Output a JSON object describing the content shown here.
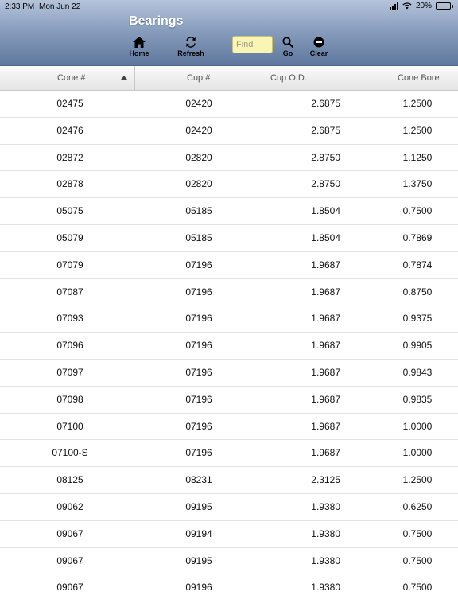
{
  "status_bar": {
    "time": "2:33 PM",
    "date": "Mon Jun 22",
    "battery": "20%",
    "battery_level": 0.2
  },
  "header": {
    "title": "Bearings",
    "toolbar": {
      "home_label": "Home",
      "refresh_label": "Refresh",
      "find_placeholder": "Find",
      "find_value": "",
      "go_label": "Go",
      "clear_label": "Clear"
    },
    "colors": {
      "bar_top": "#b6c4da",
      "bar_bottom": "#5e779c",
      "find_bg": "#fbf5b5"
    }
  },
  "table": {
    "columns": [
      "Cone #",
      "Cup #",
      "Cup O.D.",
      "Cone Bore"
    ],
    "sort_column": "Cone #",
    "sort_direction": "ascending",
    "rows": [
      [
        "02475",
        "02420",
        "2.6875",
        "1.2500"
      ],
      [
        "02476",
        "02420",
        "2.6875",
        "1.2500"
      ],
      [
        "02872",
        "02820",
        "2.8750",
        "1.1250"
      ],
      [
        "02878",
        "02820",
        "2.8750",
        "1.3750"
      ],
      [
        "05075",
        "05185",
        "1.8504",
        "0.7500"
      ],
      [
        "05079",
        "05185",
        "1.8504",
        "0.7869"
      ],
      [
        "07079",
        "07196",
        "1.9687",
        "0.7874"
      ],
      [
        "07087",
        "07196",
        "1.9687",
        "0.8750"
      ],
      [
        "07093",
        "07196",
        "1.9687",
        "0.9375"
      ],
      [
        "07096",
        "07196",
        "1.9687",
        "0.9905"
      ],
      [
        "07097",
        "07196",
        "1.9687",
        "0.9843"
      ],
      [
        "07098",
        "07196",
        "1.9687",
        "0.9835"
      ],
      [
        "07100",
        "07196",
        "1.9687",
        "1.0000"
      ],
      [
        "07100-S",
        "07196",
        "1.9687",
        "1.0000"
      ],
      [
        "08125",
        "08231",
        "2.3125",
        "1.2500"
      ],
      [
        "09062",
        "09195",
        "1.9380",
        "0.6250"
      ],
      [
        "09067",
        "09194",
        "1.9380",
        "0.7500"
      ],
      [
        "09067",
        "09195",
        "1.9380",
        "0.7500"
      ],
      [
        "09067",
        "09196",
        "1.9380",
        "0.7500"
      ]
    ]
  }
}
